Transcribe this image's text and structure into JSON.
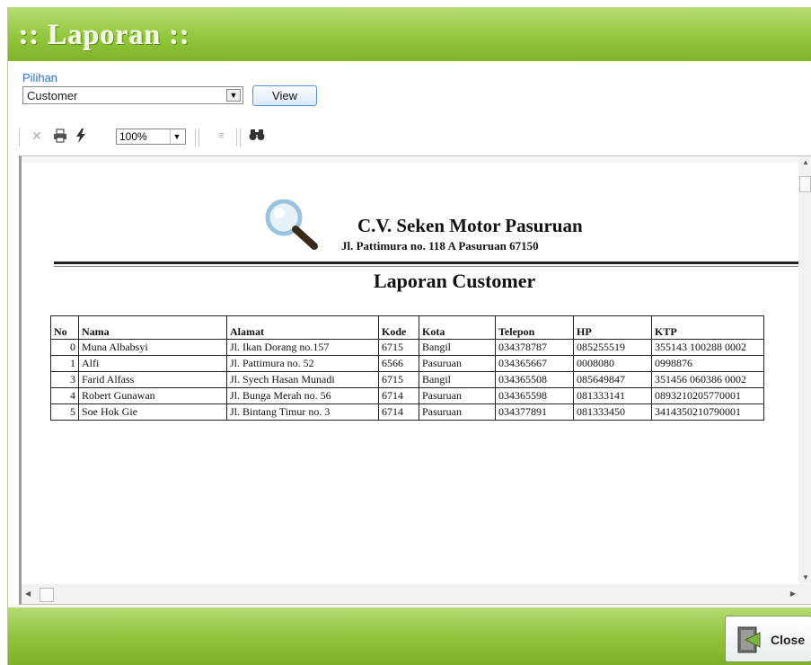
{
  "window": {
    "title": ":: Laporan ::"
  },
  "selection": {
    "label": "Pilihan",
    "selected": "Customer",
    "view_label": "View"
  },
  "toolbar": {
    "zoom": "100%"
  },
  "report": {
    "company": "C.V. Seken Motor Pasuruan",
    "address": "Jl. Pattimura no. 118 A Pasuruan 67150",
    "title": "Laporan Customer",
    "columns": [
      "No",
      "Nama",
      "Alamat",
      "Kode",
      "Kota",
      "Telepon",
      "HP",
      "KTP"
    ],
    "rows": [
      [
        "0",
        "Muna Albabsyi",
        "Jl. Ikan Dorang no.157",
        "6715",
        "Bangil",
        "034378787",
        "085255519",
        "355143 100288 0002"
      ],
      [
        "1",
        "Alfi",
        "Jl. Pattimura no. 52",
        "6566",
        "Pasuruan",
        "034365667",
        "0008080",
        "0998876"
      ],
      [
        "3",
        "Farid Alfass",
        "Jl. Syech Hasan Munadi",
        "6715",
        "Bangil",
        "034365508",
        "085649847",
        "351456 060386 0002"
      ],
      [
        "4",
        "Robert Gunawan",
        "Jl. Bunga Merah no. 56",
        "6714",
        "Pasuruan",
        "034365598",
        "081333141",
        "0893210205770001"
      ],
      [
        "5",
        "Soe Hok Gie",
        "Jl. Bintang Timur no. 3",
        "6714",
        "Pasuruan",
        "034377891",
        "081333450",
        "3414350210790001"
      ]
    ]
  },
  "footer": {
    "close_label": "Close"
  }
}
